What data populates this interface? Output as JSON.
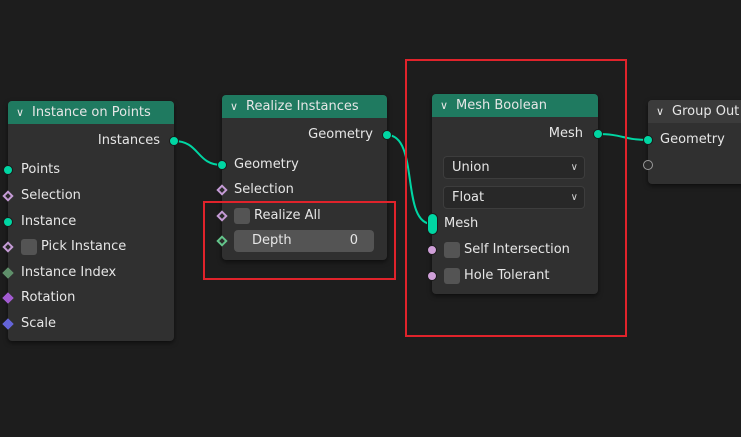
{
  "nodes": {
    "instance_on_points": {
      "title": "Instance on Points",
      "output": "Instances",
      "inputs": [
        "Points",
        "Selection",
        "Instance",
        "Pick Instance",
        "Instance Index",
        "Rotation",
        "Scale"
      ]
    },
    "realize_instances": {
      "title": "Realize Instances",
      "output": "Geometry",
      "inputs": [
        "Geometry",
        "Selection"
      ],
      "realize_all_label": "Realize All",
      "depth_label": "Depth",
      "depth_value": "0"
    },
    "mesh_boolean": {
      "title": "Mesh Boolean",
      "output": "Mesh",
      "operation": "Union",
      "solver_mode": "Float",
      "inputs": [
        "Mesh",
        "Self Intersection",
        "Hole Tolerant"
      ]
    },
    "group_output": {
      "title": "Group Out",
      "inputs": [
        "Geometry"
      ]
    }
  },
  "colors": {
    "background": "#1d1d1d",
    "node_body": "#303030",
    "node_header": "#1f7a60",
    "geometry_socket": "#00d6a3",
    "boolean_socket": "#cf9fd8",
    "highlight_box": "#e0232b"
  },
  "icons": [
    "chevron-down-icon",
    "dropdown-caret-icon"
  ]
}
